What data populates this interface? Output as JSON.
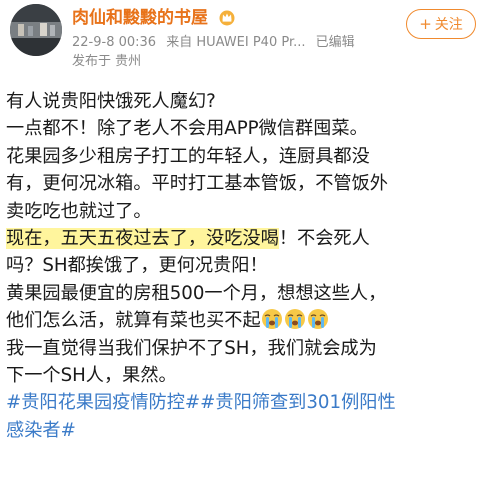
{
  "header": {
    "username": "肉仙和黢黢的书屋",
    "timestamp": "22-9-8 00:36",
    "source": "来自 HUAWEI P40 Pr...",
    "edited": "已编辑",
    "location": "发布于 贵州",
    "follow_label": "关注",
    "follow_plus": "+"
  },
  "post": {
    "line1": "有人说贵阳快饿死人魔幻?",
    "line2": "一点都不！除了老人不会用APP微信群囤菜。",
    "line3": "花果园多少租房子打工的年轻人，连厨具都没",
    "line4": "有，更何况冰箱。平时打工基本管饭，不管饭外",
    "line5": "卖吃吃也就过了。",
    "line6_highlight": "现在，五天五夜过去了，没吃没喝",
    "line6_rest": "！不会死人",
    "line7": "吗？SH都挨饿了，更何况贵阳！",
    "line8": "黄果园最便宜的房租500一个月，想想这些人，",
    "line9": "他们怎么活，就算有菜也买不起",
    "line10": "我一直觉得当我们保护不了SH，我们就会成为",
    "line11": "下一个SH人，果然。",
    "tag1": "#贵阳花果园疫情防控#",
    "tag2": "#贵阳筛查到301例阳性",
    "tag2_cont": "感染者#"
  },
  "icons": {
    "crown": "crown-icon",
    "crying": "crying-face-icon"
  },
  "colors": {
    "username": "#e8731a",
    "follow": "#f08a2e",
    "hashtag": "#3b7bc8",
    "highlight": "#fff59d",
    "meta": "#8a8a8a"
  }
}
